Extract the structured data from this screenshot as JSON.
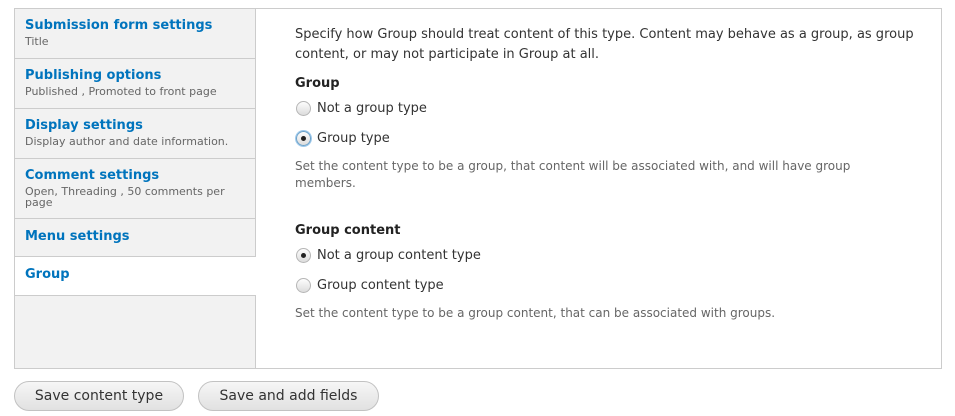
{
  "tabs": [
    {
      "title": "Submission form settings",
      "summary": "Title"
    },
    {
      "title": "Publishing options",
      "summary": "Published , Promoted to front page"
    },
    {
      "title": "Display settings",
      "summary": "Display author and date information."
    },
    {
      "title": "Comment settings",
      "summary": "Open, Threading , 50 comments per page"
    },
    {
      "title": "Menu settings",
      "summary": ""
    },
    {
      "title": "Group",
      "summary": ""
    }
  ],
  "pane": {
    "intro": "Specify how Group should treat content of this type. Content may behave as a group, as group content, or may not participate in Group at all.",
    "group": {
      "label": "Group",
      "options": [
        "Not a group type",
        "Group type"
      ],
      "selected": "Group type",
      "description": "Set the content type to be a group, that content will be associated with, and will have group members."
    },
    "group_content": {
      "label": "Group content",
      "options": [
        "Not a group content type",
        "Group content type"
      ],
      "selected": "Not a group content type",
      "description": "Set the content type to be a group content, that can be associated with groups."
    }
  },
  "buttons": {
    "save": "Save content type",
    "save_add_fields": "Save and add fields"
  }
}
